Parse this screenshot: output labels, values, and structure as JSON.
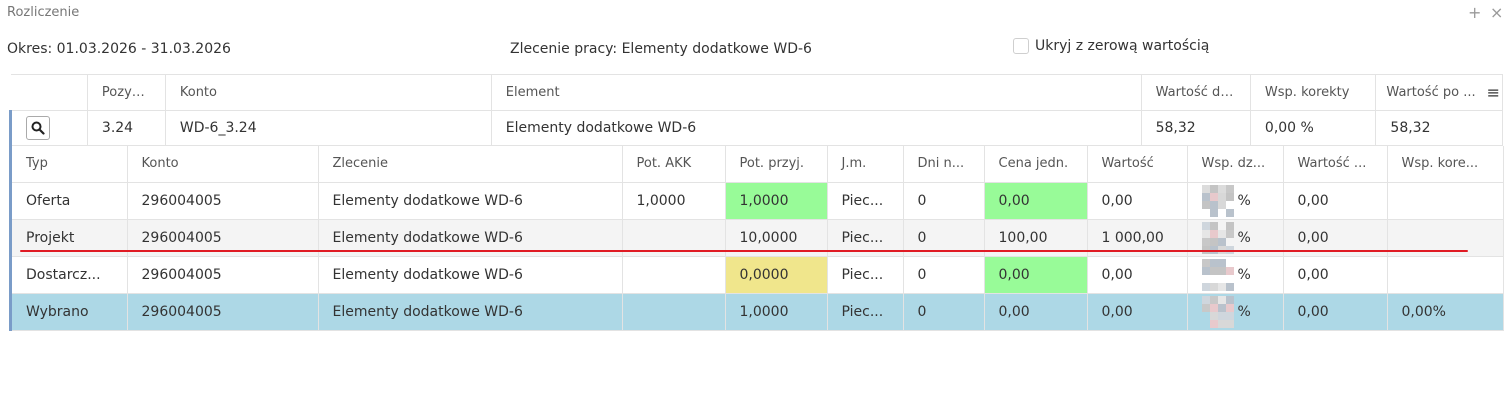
{
  "window": {
    "title": "Rozliczenie",
    "plus_icon": "+",
    "close_icon": "×"
  },
  "info": {
    "okres": "Okres: 01.03.2026 - 31.03.2026",
    "zlecenie": "Zlecenie pracy: Elementy dodatkowe WD-6",
    "hide_zero_label": "Ukryj z zerową wartością",
    "hide_zero_checked": false
  },
  "outer": {
    "headers": [
      "",
      "Pozycja...",
      "Konto",
      "Element",
      "Wartość dzi...",
      "Wsp. korekty",
      "Wartość po ..."
    ],
    "menu_icon": "≡",
    "row": {
      "pozycja": "3.24",
      "konto": "WD-6_3.24",
      "element": "Elementy dodatkowe WD-6",
      "wartosc_dzi": "58,32",
      "wsp_korekty": "0,00 %",
      "wartosc_po": "58,32"
    }
  },
  "inner": {
    "headers": [
      "Typ",
      "Konto",
      "Zlecenie",
      "Pot. AKK",
      "Pot. przyj.",
      "J.m.",
      "Dni n...",
      "Cena jedn.",
      "Wartość",
      "Wsp. dz...",
      "Wartość ...",
      "Wsp. kore..."
    ],
    "rows": [
      {
        "typ": "Oferta",
        "konto": "296004005",
        "zlecenie": "Elementy dodatkowe WD-6",
        "pot_akk": "1,0000",
        "pot_przyj": "1,0000",
        "jm": "Piec...",
        "dni": "0",
        "cena": "0,00",
        "wartosc": "0,00",
        "wsp_dz": "%",
        "wartosc2": "0,00",
        "wsp_kore": ""
      },
      {
        "typ": "Projekt",
        "konto": "296004005",
        "zlecenie": "Elementy dodatkowe WD-6",
        "pot_akk": "",
        "pot_przyj": "10,0000",
        "jm": "Piec...",
        "dni": "0",
        "cena": "100,00",
        "wartosc": "1 000,00",
        "wsp_dz": "%",
        "wartosc2": "0,00",
        "wsp_kore": ""
      },
      {
        "typ": "Dostarcz...",
        "konto": "296004005",
        "zlecenie": "Elementy dodatkowe WD-6",
        "pot_akk": "",
        "pot_przyj": "0,0000",
        "jm": "Piec...",
        "dni": "0",
        "cena": "0,00",
        "wartosc": "0,00",
        "wsp_dz": "%",
        "wartosc2": "0,00",
        "wsp_kore": ""
      },
      {
        "typ": "Wybrano",
        "konto": "296004005",
        "zlecenie": "Elementy dodatkowe WD-6",
        "pot_akk": "",
        "pot_przyj": "1,0000",
        "jm": "Piec...",
        "dni": "0",
        "cena": "0,00",
        "wartosc": "0,00",
        "wsp_dz": "%",
        "wartosc2": "0,00",
        "wsp_kore": "0,00%"
      }
    ]
  },
  "colors": {
    "green_cell": "#98fb98",
    "yellow_cell": "#f0e68c",
    "selected_row": "#add8e6",
    "annotation_line": "#e01b24",
    "row_marker": "#7a9cc8"
  },
  "icons": {
    "search": "search-icon",
    "menu": "hamburger-menu-icon",
    "add": "plus-icon",
    "close": "close-icon"
  }
}
